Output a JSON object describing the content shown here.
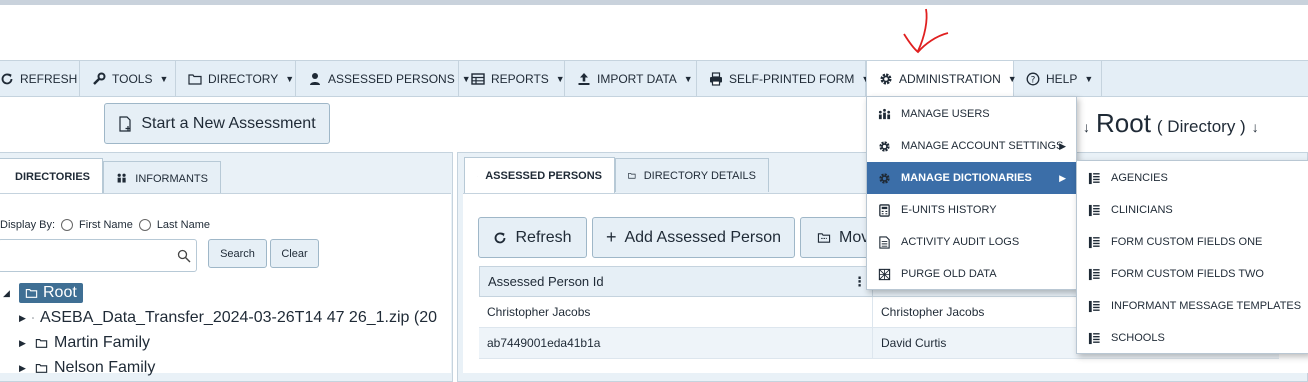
{
  "toolbar": {
    "items": [
      {
        "label": "REFRESH",
        "icon": "refresh-icon"
      },
      {
        "label": "TOOLS",
        "icon": "wrench-icon"
      },
      {
        "label": "DIRECTORY",
        "icon": "folder-icon"
      },
      {
        "label": "ASSESSED PERSONS",
        "icon": "person-icon"
      },
      {
        "label": "REPORTS",
        "icon": "table-icon"
      },
      {
        "label": "IMPORT DATA",
        "icon": "upload-icon"
      },
      {
        "label": "SELF-PRINTED FORM",
        "icon": "printer-icon"
      },
      {
        "label": "ADMINISTRATION",
        "icon": "gear-icon"
      },
      {
        "label": "HELP",
        "icon": "question-icon"
      }
    ]
  },
  "start_assessment_label": "Start a New Assessment",
  "header": {
    "title": "Root",
    "subtitle": "( Directory )"
  },
  "left_tabs": {
    "directories": "DIRECTORIES",
    "informants": "INFORMANTS"
  },
  "display_by": {
    "label": "Display By:",
    "first_name": "First Name",
    "last_name": "Last Name"
  },
  "search": {
    "value": "",
    "search_label": "Search",
    "clear_label": "Clear"
  },
  "tree": {
    "root": "Root",
    "items": [
      "ASEBA_Data_Transfer_2024-03-26T14 47 26_1.zip (20",
      "Martin Family",
      "Nelson Family"
    ]
  },
  "right_tabs": {
    "assessed_persons": "ASSESSED PERSONS",
    "directory_details": "DIRECTORY DETAILS"
  },
  "actions": {
    "refresh": "Refresh",
    "add": "Add Assessed Person",
    "move": "Mov"
  },
  "grid": {
    "columns": [
      "Assessed Person Id",
      ""
    ],
    "rows": [
      [
        "Christopher Jacobs",
        "Christopher Jacobs"
      ],
      [
        "ab7449001eda41b1a",
        "David Curtis"
      ]
    ]
  },
  "admin_menu": [
    {
      "label": "MANAGE USERS",
      "icon": "users-icon"
    },
    {
      "label": "MANAGE ACCOUNT SETTINGS",
      "icon": "gear-icon"
    },
    {
      "label": "MANAGE DICTIONARIES",
      "icon": "gear-icon"
    },
    {
      "label": "E-UNITS HISTORY",
      "icon": "calculator-icon"
    },
    {
      "label": "ACTIVITY AUDIT LOGS",
      "icon": "document-icon"
    },
    {
      "label": "PURGE OLD DATA",
      "icon": "grid-icon"
    }
  ],
  "dictionaries_menu": [
    "AGENCIES",
    "CLINICIANS",
    "FORM CUSTOM FIELDS ONE",
    "FORM CUSTOM FIELDS TWO",
    "INFORMANT MESSAGE TEMPLATES",
    "SCHOOLS"
  ],
  "colors": {
    "accent": "#3b6ea8",
    "toolbar": "#e4eef6",
    "annotation": "#e02020",
    "root_badge": "#3f6f94"
  }
}
